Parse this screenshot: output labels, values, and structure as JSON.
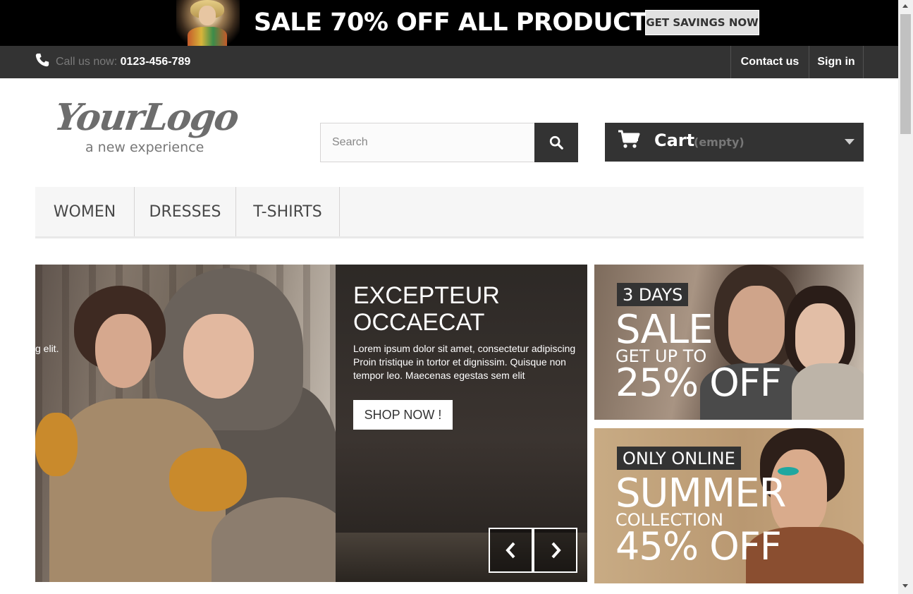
{
  "promo": {
    "text": "SALE 70% OFF ALL PRODUCTS",
    "button_label": "GET SAVINGS NOW"
  },
  "topbar": {
    "call_label": "Call us now: ",
    "phone": "0123-456-789",
    "contact_label": "Contact us",
    "signin_label": "Sign in"
  },
  "header": {
    "logo_text": "YourLogo",
    "logo_tagline": "a new experience",
    "search_placeholder": "Search",
    "search_value": "",
    "cart_label": "Cart",
    "cart_status": "(empty)"
  },
  "nav": {
    "items": [
      {
        "label": "WOMEN"
      },
      {
        "label": "DRESSES"
      },
      {
        "label": "T-SHIRTS"
      }
    ]
  },
  "slider": {
    "prev_slide_fragment": "g elit.",
    "title_line1": "EXCEPTEUR",
    "title_line2": "OCCAECAT",
    "desc_line1": "Lorem ipsum dolor sit amet, consectetur adipiscing",
    "desc_line2": "Proin tristique in tortor et dignissim. Quisque non",
    "desc_line3": "tempor leo. Maecenas egestas sem elit",
    "button_label": "SHOP NOW !"
  },
  "banners": [
    {
      "tag": "3 DAYS",
      "big": "SALE",
      "mid": "GET UP TO",
      "offer": "25% OFF"
    },
    {
      "tag": "ONLY ONLINE",
      "big": "SUMMER",
      "mid": "COLLECTION",
      "offer": "45% OFF"
    }
  ],
  "colors": {
    "dark": "#333333",
    "nav_bg": "#f6f6f6",
    "accent_white": "#ffffff"
  },
  "icons": {
    "phone": "phone-icon",
    "search": "search-icon",
    "cart": "cart-icon",
    "prev": "chevron-left-icon",
    "next": "chevron-right-icon",
    "dropdown": "caret-down-icon"
  }
}
